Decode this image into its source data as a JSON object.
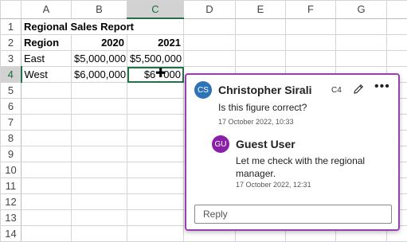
{
  "columns": [
    "A",
    "B",
    "C",
    "D",
    "E",
    "F",
    "G"
  ],
  "rows": [
    "1",
    "2",
    "3",
    "4",
    "5",
    "6",
    "7",
    "8",
    "9",
    "10",
    "11",
    "12",
    "13",
    "14"
  ],
  "cells": {
    "a1": "Regional Sales Report",
    "a2": "Region",
    "b2": "2020",
    "c2": "2021",
    "a3": "East",
    "b3": "$5,000,000",
    "c3": "$5,500,000",
    "a4": "West",
    "b4": "$6,000,000",
    "c4": "$6",
    "c4_tail": "000"
  },
  "comment": {
    "author_initials": "CS",
    "author": "Christopher Sirali",
    "cell_ref": "C4",
    "text": "Is this figure correct?",
    "timestamp": "17 October 2022, 10:33",
    "reply_initials": "GU",
    "reply_author": "Guest User",
    "reply_text": "Let me check with the regional manager.",
    "reply_timestamp": "17 October 2022, 12:31",
    "reply_placeholder": "Reply",
    "accent_color": "#9a3fb3"
  },
  "colors": {
    "selection": "#217346",
    "header_highlight": "#d2d2d2"
  }
}
